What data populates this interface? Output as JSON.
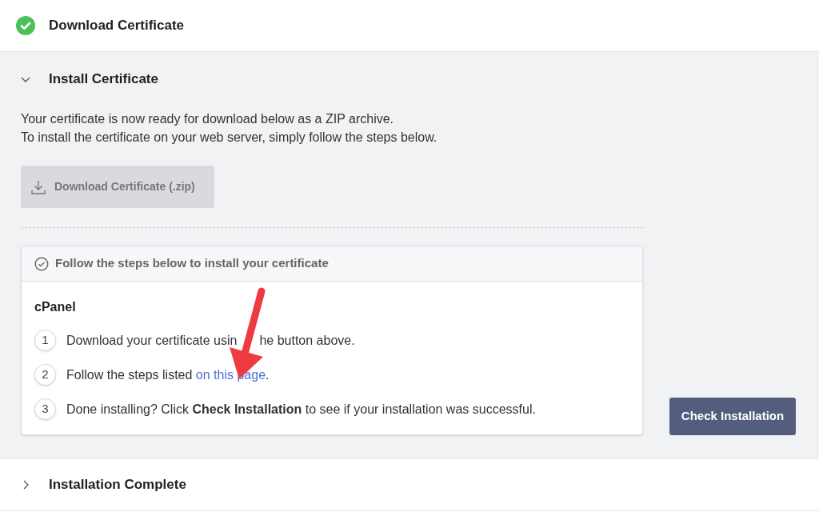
{
  "sections": [
    {
      "title": "Download Certificate",
      "kind": "done",
      "expanded": false
    },
    {
      "title": "Install Certificate",
      "kind": "step",
      "expanded": true
    },
    {
      "title": "Installation Complete",
      "kind": "step",
      "expanded": false
    }
  ],
  "install": {
    "intro": [
      "Your certificate is now ready for download below as a ZIP archive.",
      "To install the certificate on your web server, simply follow the steps below."
    ],
    "download_button": {
      "label": "Download Certificate (.zip)",
      "disabled": true
    },
    "steps_card": {
      "title": "Follow the steps below to install your certificate",
      "platform": "cPanel",
      "steps": [
        {
          "number": "1",
          "text": "Download your certificate usin",
          "text_after_arrow": "he button above."
        },
        {
          "number": "2",
          "text": "Follow the steps listed",
          "link": "on this page",
          "after": "."
        },
        {
          "number": "3",
          "text": "Done installing? Click **Check Installation** to see if your installation was successful."
        }
      ]
    },
    "check_button": "Check Installation"
  }
}
